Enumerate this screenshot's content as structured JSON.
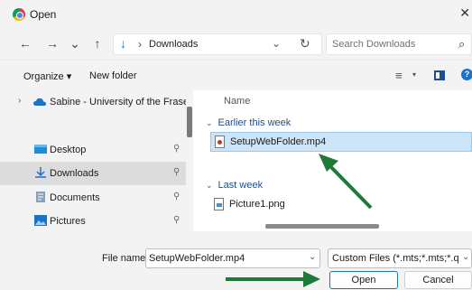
{
  "window": {
    "title": "Open",
    "close": "✕"
  },
  "nav": {
    "back": "←",
    "forward": "→",
    "recent": "⌄",
    "up": "↑",
    "address": {
      "separator": "›",
      "path": "Downloads",
      "dropdown": "⌄",
      "refresh": "↻"
    },
    "search": {
      "placeholder": "Search Downloads",
      "icon": "⌕"
    }
  },
  "commandbar": {
    "organize": "Organize ▾",
    "new_folder": "New folder",
    "view_icon": "≡",
    "view_drop": "▾",
    "help": "?"
  },
  "sidebar": {
    "items": [
      {
        "label": "Sabine - University of the Fraser V",
        "chevron": "›",
        "icon": "cloud-icon"
      },
      {
        "label": "Desktop",
        "icon": "desktop-icon",
        "pin": "📌"
      },
      {
        "label": "Downloads",
        "icon": "download-icon",
        "pin": "📌",
        "selected": true
      },
      {
        "label": "Documents",
        "icon": "document-icon",
        "pin": "📌"
      },
      {
        "label": "Pictures",
        "icon": "pictures-icon",
        "pin": "📌"
      }
    ]
  },
  "content": {
    "column_name": "Name",
    "groups": [
      {
        "label": "Earlier this week",
        "chevron": "⌄",
        "files": [
          {
            "name": "SetupWebFolder.mp4",
            "icon": "video-file-icon",
            "selected": true
          }
        ]
      },
      {
        "label": "Last week",
        "chevron": "⌄",
        "files": [
          {
            "name": "Picture1.png",
            "icon": "image-file-icon"
          }
        ]
      }
    ]
  },
  "footer": {
    "file_name_label": "File name:",
    "file_name_value": "SetupWebFolder.mp4",
    "dropdown": "⌄",
    "file_type": "Custom Files (*.mts;*.mts;*.qt;*.",
    "open": "Open",
    "cancel": "Cancel"
  },
  "colors": {
    "accent": "#1a73c8",
    "annotation_arrow": "#1f7a3a",
    "selection": "#cce4f7"
  }
}
